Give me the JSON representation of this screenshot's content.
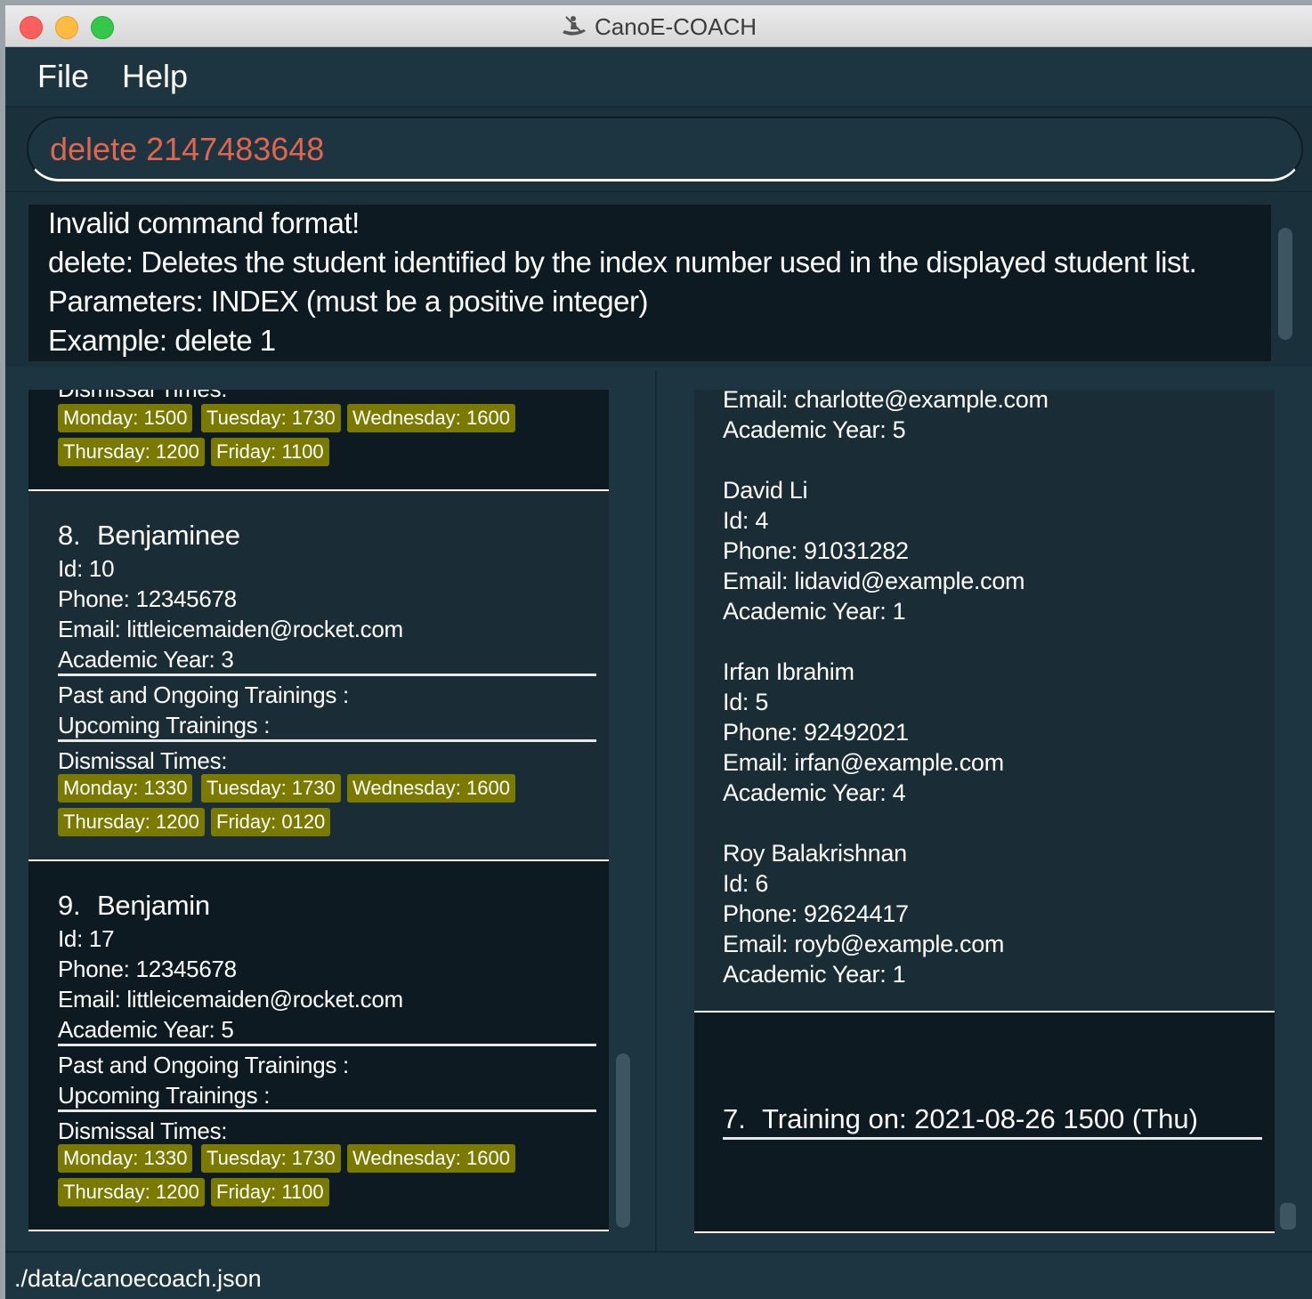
{
  "window": {
    "title": "CanoE-COACH"
  },
  "menu": {
    "file": "File",
    "help": "Help"
  },
  "command": {
    "value": "delete 2147483648"
  },
  "result": {
    "lines": [
      "Invalid command format!",
      "delete: Deletes the student identified by the index number used in the displayed student list.",
      "Parameters: INDEX (must be a positive integer)",
      "Example: delete 1"
    ]
  },
  "students": {
    "partial": {
      "dismissal_label": "Dismissal Times:",
      "times": [
        "Monday: 1500",
        "Tuesday: 1730",
        "Wednesday: 1600",
        "Thursday: 1200",
        "Friday: 1100"
      ]
    },
    "items": [
      {
        "index": "8.",
        "name": "Benjaminee",
        "id": "Id: 10",
        "phone": "Phone: 12345678",
        "email": "Email: littleicemaiden@rocket.com",
        "year": "Academic Year: 3",
        "past": "Past and Ongoing Trainings :",
        "upcoming": "Upcoming Trainings :",
        "dismissal_label": "Dismissal Times:",
        "times": [
          "Monday: 1330",
          "Tuesday: 1730",
          "Wednesday: 1600",
          "Thursday: 1200",
          "Friday: 0120"
        ]
      },
      {
        "index": "9.",
        "name": "Benjamin",
        "id": "Id: 17",
        "phone": "Phone: 12345678",
        "email": "Email: littleicemaiden@rocket.com",
        "year": "Academic Year: 5",
        "past": "Past and Ongoing Trainings :",
        "upcoming": "Upcoming Trainings :",
        "dismissal_label": "Dismissal Times:",
        "times": [
          "Monday: 1330",
          "Tuesday: 1730",
          "Wednesday: 1600",
          "Thursday: 1200",
          "Friday: 1100"
        ]
      }
    ]
  },
  "trainings": {
    "partial_lines": [
      "Email: charlotte@example.com",
      "Academic  Year: 5"
    ],
    "attendees": [
      {
        "name": "David Li",
        "id": "Id: 4",
        "phone": "Phone: 91031282",
        "email": "Email: lidavid@example.com",
        "year": "Academic  Year: 1"
      },
      {
        "name": "Irfan Ibrahim",
        "id": "Id: 5",
        "phone": "Phone: 92492021",
        "email": "Email: irfan@example.com",
        "year": "Academic  Year: 4"
      },
      {
        "name": "Roy Balakrishnan",
        "id": "Id: 6",
        "phone": "Phone: 92624417",
        "email": "Email: royb@example.com",
        "year": "Academic  Year: 1"
      }
    ],
    "next": {
      "index": "7.",
      "title": "Training on: 2021-08-26 1500 (Thu)"
    }
  },
  "status": {
    "file_path": "./data/canoecoach.json"
  },
  "colors": {
    "background": "#1d3540",
    "card_dark": "#0d1a21",
    "tag": "#7b7a00",
    "command_text": "#e1654f"
  }
}
